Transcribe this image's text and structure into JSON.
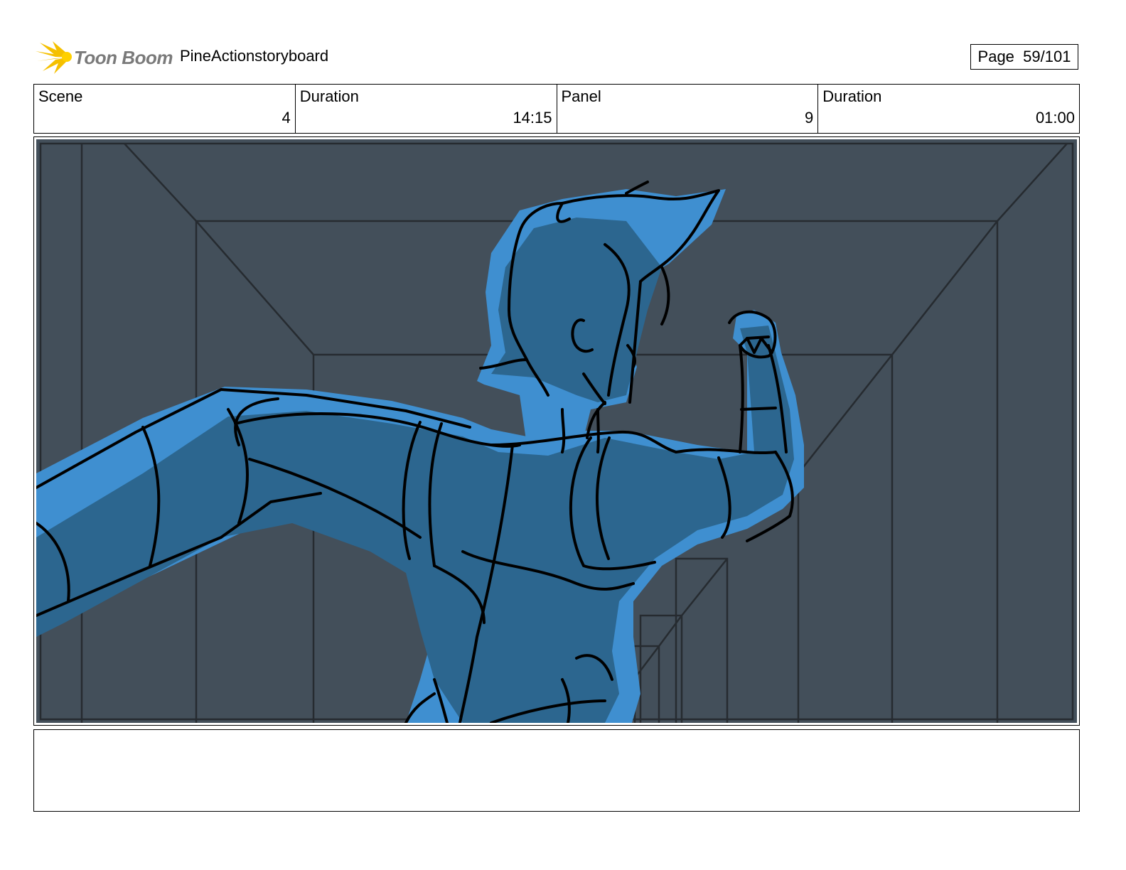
{
  "header": {
    "logo_text": "Toon Boom",
    "project_title": "PineActionstoryboard",
    "page_label": "Page",
    "page_value": "59/101"
  },
  "info": {
    "scene_label": "Scene",
    "scene_value": "4",
    "scene_duration_label": "Duration",
    "scene_duration_value": "14:15",
    "panel_label": "Panel",
    "panel_value": "9",
    "panel_duration_label": "Duration",
    "panel_duration_value": "01:00"
  },
  "panel": {
    "background_color": "#434f5a",
    "line_color": "#262b30",
    "figure_highlight_color": "#3f8fd0",
    "figure_fill_color": "#2c668f"
  },
  "notes": {
    "text": ""
  }
}
